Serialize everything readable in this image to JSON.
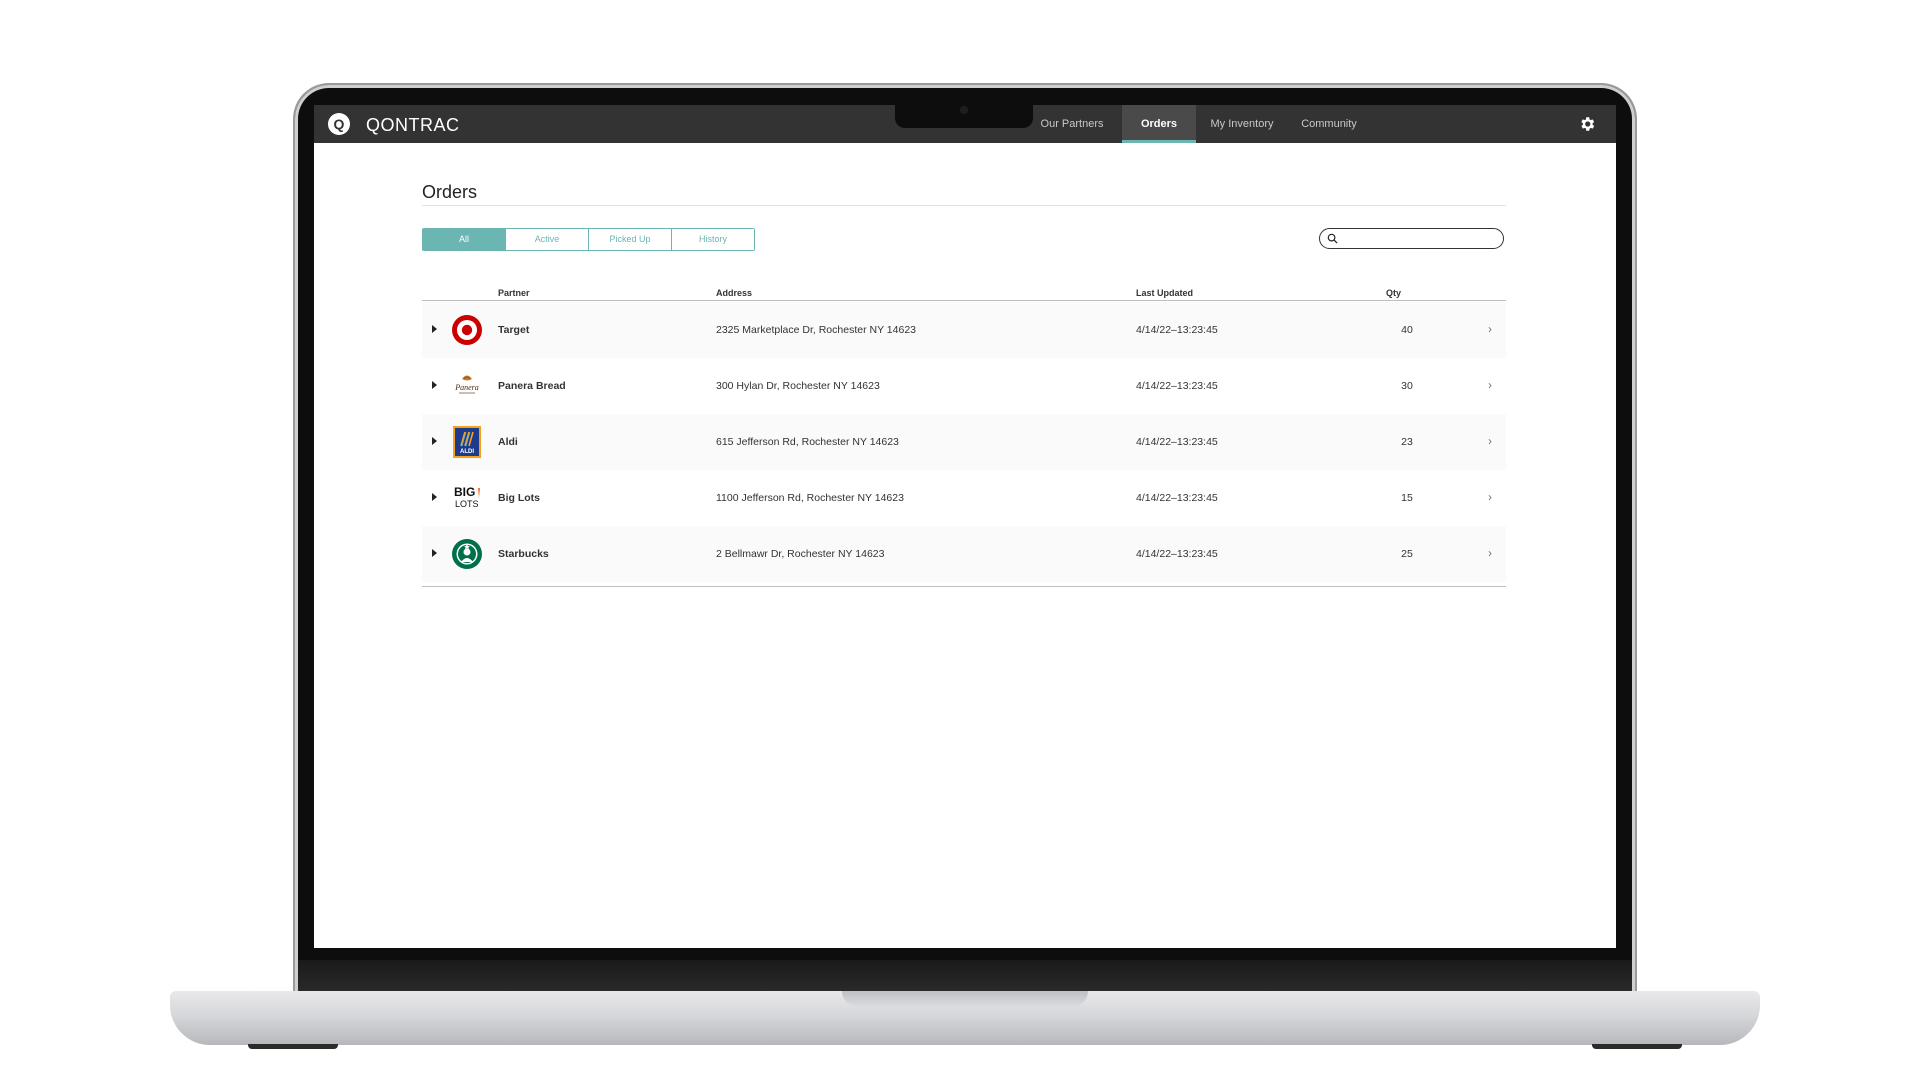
{
  "app": {
    "brand": "QONTRAC",
    "logo_letter": "Q"
  },
  "nav": {
    "items": [
      {
        "label": "Our Partners",
        "active": false
      },
      {
        "label": "Orders",
        "active": true
      },
      {
        "label": "My Inventory",
        "active": false
      },
      {
        "label": "Community",
        "active": false
      }
    ],
    "settings_icon": "gear-icon"
  },
  "page": {
    "title": "Orders"
  },
  "tabs": [
    {
      "label": "All",
      "active": true
    },
    {
      "label": "Active",
      "active": false
    },
    {
      "label": "Picked Up",
      "active": false
    },
    {
      "label": "History",
      "active": false
    }
  ],
  "search": {
    "placeholder": "",
    "icon": "search-icon"
  },
  "table": {
    "headers": {
      "partner": "Partner",
      "address": "Address",
      "updated": "Last Updated",
      "qty": "Qty"
    },
    "rows": [
      {
        "partner": "Target",
        "address": "2325 Marketplace Dr, Rochester NY 14623",
        "updated": "4/14/22–13:23:45",
        "qty": "40",
        "logo": "target-logo"
      },
      {
        "partner": "Panera Bread",
        "address": "300 Hylan Dr, Rochester NY 14623",
        "updated": "4/14/22–13:23:45",
        "qty": "30",
        "logo": "panera-logo"
      },
      {
        "partner": "Aldi",
        "address": "615 Jefferson Rd, Rochester NY 14623",
        "updated": "4/14/22–13:23:45",
        "qty": "23",
        "logo": "aldi-logo"
      },
      {
        "partner": "Big Lots",
        "address": "1100 Jefferson Rd, Rochester NY 14623",
        "updated": "4/14/22–13:23:45",
        "qty": "15",
        "logo": "biglots-logo"
      },
      {
        "partner": "Starbucks",
        "address": "2 Bellmawr Dr, Rochester NY 14623",
        "updated": "4/14/22–13:23:45",
        "qty": "25",
        "logo": "starbucks-logo"
      }
    ]
  },
  "logo_text": {
    "panera": "Panera",
    "aldi": "ALDI",
    "biglots_top": "BIG",
    "biglots_bottom": "LOTS"
  },
  "colors": {
    "accent": "#6bb5b2",
    "navbar": "#333333",
    "target_red": "#cc0000",
    "aldi_blue": "#1d3b8c",
    "aldi_orange": "#f4a21a",
    "starbucks_green": "#00704a"
  }
}
